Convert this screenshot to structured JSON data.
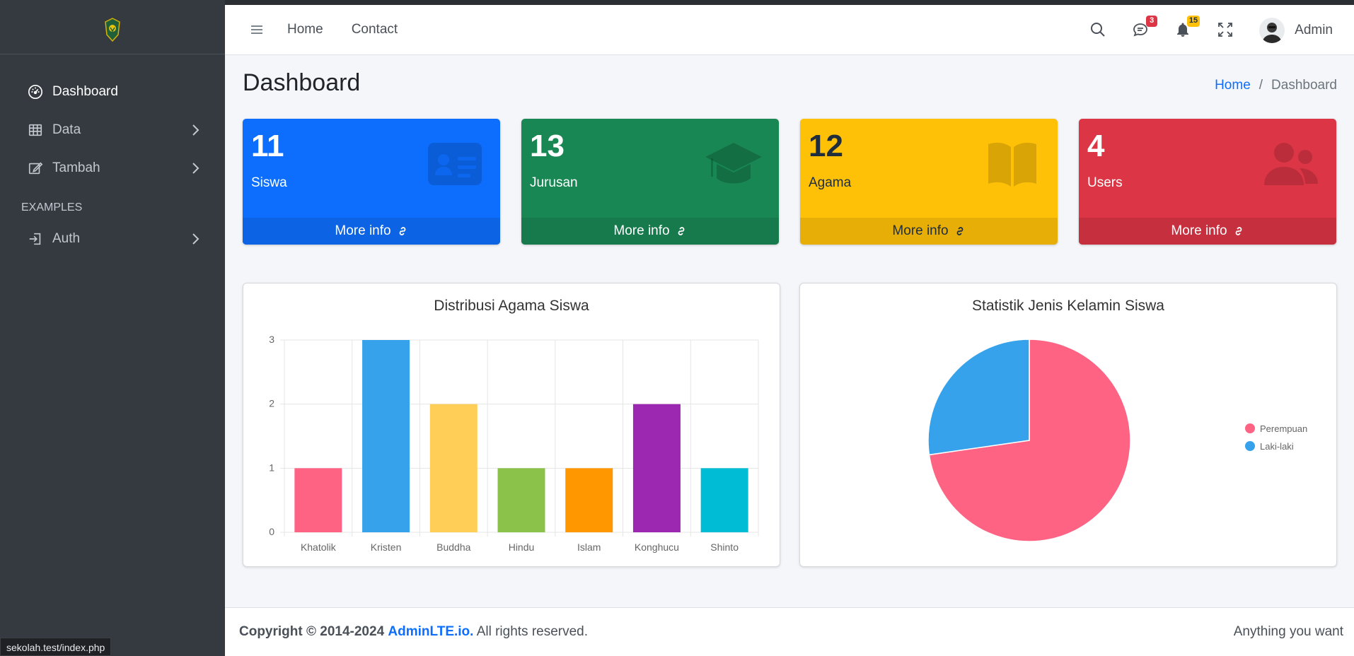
{
  "sidebar": {
    "items": [
      {
        "label": "Dashboard",
        "icon": "speedometer-icon",
        "active": true
      },
      {
        "label": "Data",
        "icon": "table-icon"
      },
      {
        "label": "Tambah",
        "icon": "pencil-square-icon"
      }
    ],
    "header": "EXAMPLES",
    "auth_item": {
      "label": "Auth",
      "icon": "box-arrow-in-right-icon"
    }
  },
  "navbar": {
    "links": [
      "Home",
      "Contact"
    ],
    "messages_badge": "3",
    "notifications_badge": "15",
    "user": "Admin"
  },
  "page": {
    "title": "Dashboard",
    "breadcrumb": {
      "home": "Home",
      "current": "Dashboard"
    }
  },
  "boxes": [
    {
      "number": "11",
      "label": "Siswa",
      "more": "More info",
      "color": "#0d6efd",
      "footer_color": "#0c63e4",
      "icon": "id-card-icon"
    },
    {
      "number": "13",
      "label": "Jurusan",
      "more": "More info",
      "color": "#198754",
      "footer_color": "#177a4c",
      "icon": "graduation-cap-icon"
    },
    {
      "number": "12",
      "label": "Agama",
      "more": "More info",
      "color": "#ffc107",
      "footer_color": "#e6ae06",
      "icon": "book-icon"
    },
    {
      "number": "4",
      "label": "Users",
      "more": "More info",
      "color": "#dc3545",
      "footer_color": "#c6303e",
      "icon": "users-icon"
    }
  ],
  "chart_data": [
    {
      "type": "bar",
      "title": "Distribusi Agama Siswa",
      "categories": [
        "Khatolik",
        "Kristen",
        "Buddha",
        "Hindu",
        "Islam",
        "Konghucu",
        "Shinto"
      ],
      "values": [
        1,
        3,
        2,
        1,
        1,
        2,
        1
      ],
      "colors": [
        "#ff6384",
        "#36a2eb",
        "#ffce56",
        "#8bc34a",
        "#ff9800",
        "#9c27b0",
        "#00bcd4"
      ],
      "ylim": [
        0,
        3
      ],
      "yticks": [
        "0",
        "1",
        "2",
        "3"
      ],
      "grid": true
    },
    {
      "type": "pie",
      "title": "Statistik Jenis Kelamin Siswa",
      "labels": [
        "Perempuan",
        "Laki-laki"
      ],
      "values": [
        8,
        3
      ],
      "colors": [
        "#ff6384",
        "#36a2eb"
      ],
      "legend": "right"
    }
  ],
  "footer": {
    "copyright": "Copyright © 2014-2024",
    "brand": "AdminLTE.io.",
    "rights": "All rights reserved.",
    "right_text": "Anything you want"
  },
  "status_url": "sekolah.test/index.php"
}
